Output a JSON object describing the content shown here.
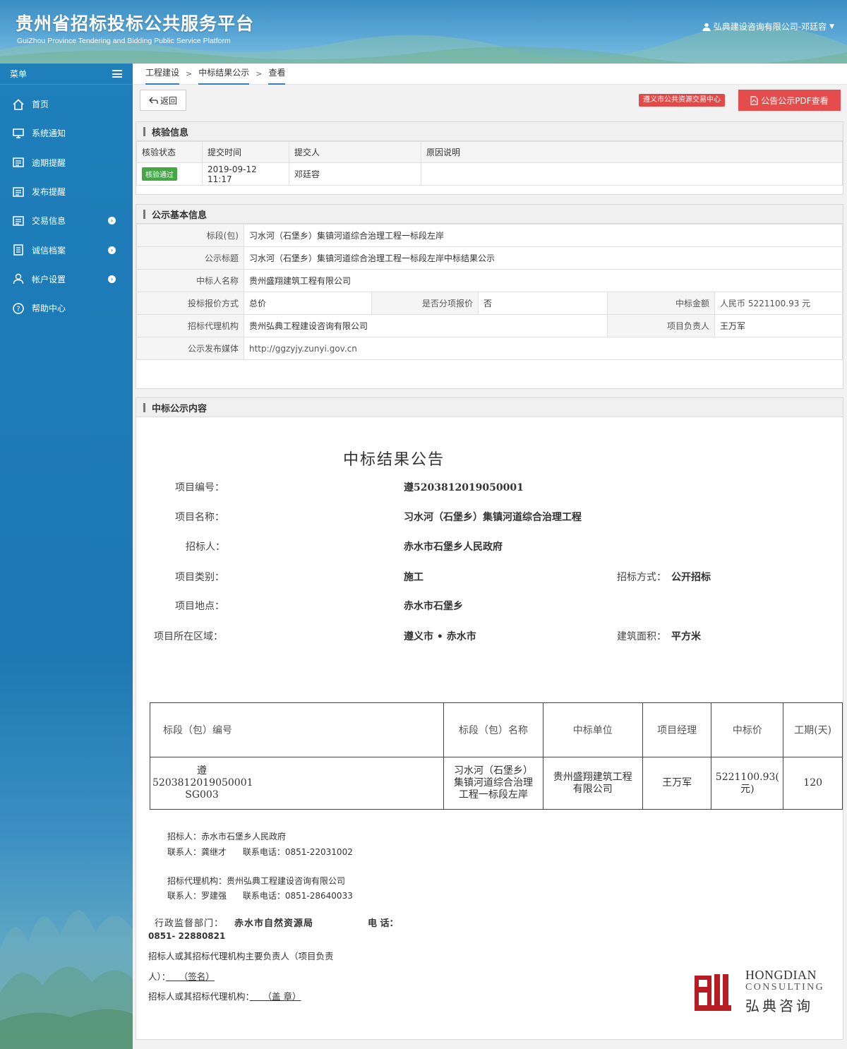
{
  "header": {
    "title_cn": "贵州省招标投标公共服务平台",
    "title_en": "GuiZhou Province Tendering and Bidding Public Service Platform",
    "user": "弘典建设咨询有限公司-邓廷容"
  },
  "sidebar": {
    "menu_label": "菜单",
    "items": [
      {
        "label": "首页"
      },
      {
        "label": "系统通知"
      },
      {
        "label": "逾期提醒"
      },
      {
        "label": "发布提醒"
      },
      {
        "label": "交易信息"
      },
      {
        "label": "诚信档案"
      },
      {
        "label": "帐户设置"
      },
      {
        "label": "帮助中心"
      }
    ]
  },
  "breadcrumb": [
    "工程建设",
    "中标结果公示",
    "查看"
  ],
  "toolbar": {
    "back_label": "返回",
    "center_tag": "遵义市公共资源交易中心",
    "pdf_label": "公告公示PDF查看"
  },
  "verify": {
    "title": "核验信息",
    "headers": [
      "核验状态",
      "提交时间",
      "提交人",
      "原因说明"
    ],
    "status": "核验通过",
    "time": "2019-09-12 11:17",
    "submitter": "邓廷容",
    "reason": ""
  },
  "basic": {
    "title": "公示基本信息",
    "section_label": "标段(包)",
    "section_value": "习水河（石堡乡）集镇河道综合治理工程一标段左岸",
    "notice_title_label": "公示标题",
    "notice_title_value": "习水河（石堡乡）集镇河道综合治理工程一标段左岸中标结果公示",
    "winner_label": "中标人名称",
    "winner_value": "贵州盛翔建筑工程有限公司",
    "quote_label": "投标报价方式",
    "quote_value": "总价",
    "split_label": "是否分项报价",
    "split_value": "否",
    "amount_label": "中标金额",
    "amount_value": "人民币 5221100.93 元",
    "agency_label": "招标代理机构",
    "agency_value": "贵州弘典工程建设咨询有限公司",
    "leader_label": "项目负责人",
    "leader_value": "王万军",
    "media_label": "公示发布媒体",
    "media_value": "http://ggzyjy.zunyi.gov.cn"
  },
  "content": {
    "title": "中标公示内容",
    "doc_title": "中标结果公告",
    "project_no_label": "项目编号：",
    "project_no": "遵5203812019050001",
    "project_name_label": "项目名称：",
    "project_name": "习水河（石堡乡）集镇河道综合治理工程",
    "tenderer_label": "招标人：",
    "tenderer": "赤水市石堡乡人民政府",
    "category_label": "项目类别：",
    "category": "施工",
    "method_label": "招标方式：",
    "method": "公开招标",
    "location_label": "项目地点：",
    "location": "赤水市石堡乡",
    "region_label": "项目所在区域：",
    "region": "遵义市 • 赤水市",
    "area_label": "建筑面积：",
    "area": "平方米",
    "table_headers": [
      "标段（包）编号",
      "标段（包）名称",
      "中标单位",
      "项目经理",
      "中标价",
      "工期(天)"
    ],
    "row": {
      "no_line1": "遵",
      "no_line2": "5203812019050001",
      "no_line3": "SG003",
      "name_line1": "习水河（石堡乡）",
      "name_line2": "集镇河道综合治理",
      "name_line3": "工程一标段左岸",
      "unit_line1": "贵州盛翔建筑工程",
      "unit_line2": "有限公司",
      "manager": "王万军",
      "price_line1": "5221100.93(",
      "price_line2": "元)",
      "days": "120"
    },
    "contact1_line1": "招标人：赤水市石堡乡人民政府",
    "contact1_line2": "联系人：龚继才      联系电话：0851-22031002",
    "contact2_line1": "招标代理机构：贵州弘典工程建设咨询有限公司",
    "contact2_line2": "联系人：罗建强      联系电话：0851-28640033",
    "supervise_label": "行政监督部门：",
    "supervise_value": "赤水市自然资源局",
    "phone_label": "电 话：",
    "phone_value": "0851- 22880821",
    "sign_line1": "招标人或其招标代理机构主要负责人（项目负责",
    "sign_line2_prefix": "人）：",
    "sign_line2_value": "　　（签名）",
    "seal_prefix": "招标人或其招标代理机构：",
    "seal_value": "　　（盖 章）",
    "logo_en1": "HONGDIAN",
    "logo_en2": "CONSULTING",
    "logo_cn": "弘典咨询"
  },
  "colors": {
    "sidebar": "#1e7fba",
    "accent": "#3a7fb0",
    "danger": "#e54d4d",
    "success": "#43a843",
    "logo_red": "#b71c24"
  }
}
